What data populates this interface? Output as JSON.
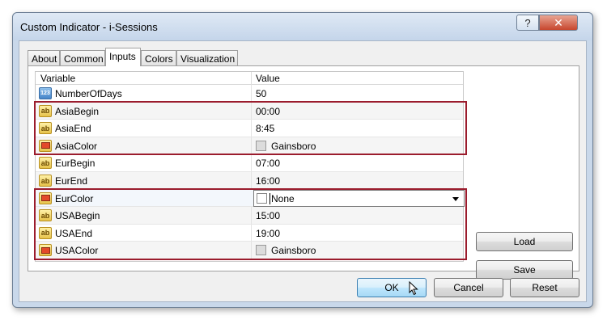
{
  "window": {
    "title": "Custom Indicator - i-Sessions",
    "help_label": "?",
    "close_label": "✕"
  },
  "tabs": [
    {
      "label": "About",
      "active": false
    },
    {
      "label": "Common",
      "active": false
    },
    {
      "label": "Inputs",
      "active": true
    },
    {
      "label": "Colors",
      "active": false
    },
    {
      "label": "Visualization",
      "active": false
    }
  ],
  "grid": {
    "columns": [
      "Variable",
      "Value"
    ],
    "rows": [
      {
        "name": "NumberOfDays",
        "value": "50",
        "icon": "number-icon"
      },
      {
        "name": "AsiaBegin",
        "value": "00:00",
        "icon": "string-icon"
      },
      {
        "name": "AsiaEnd",
        "value": "8:45",
        "icon": "string-icon"
      },
      {
        "name": "AsiaColor",
        "value": "Gainsboro",
        "icon": "color-icon",
        "swatch": "#dcdcdc"
      },
      {
        "name": "EurBegin",
        "value": "07:00",
        "icon": "string-icon"
      },
      {
        "name": "EurEnd",
        "value": "16:00",
        "icon": "string-icon"
      },
      {
        "name": "EurColor",
        "value": "None",
        "icon": "color-icon",
        "swatch": "#ffffff",
        "editing": true
      },
      {
        "name": "USABegin",
        "value": "15:00",
        "icon": "string-icon"
      },
      {
        "name": "USAEnd",
        "value": "19:00",
        "icon": "string-icon"
      },
      {
        "name": "USAColor",
        "value": "Gainsboro",
        "icon": "color-icon",
        "swatch": "#dcdcdc"
      }
    ],
    "icon_text": {
      "number": "123",
      "string": "ab"
    }
  },
  "side_buttons": {
    "load": "Load",
    "save": "Save"
  },
  "footer_buttons": {
    "ok": "OK",
    "cancel": "Cancel",
    "reset": "Reset"
  },
  "colors": {
    "highlight_border": "#9b1c2d",
    "title_bar": "#c9d8ea"
  }
}
